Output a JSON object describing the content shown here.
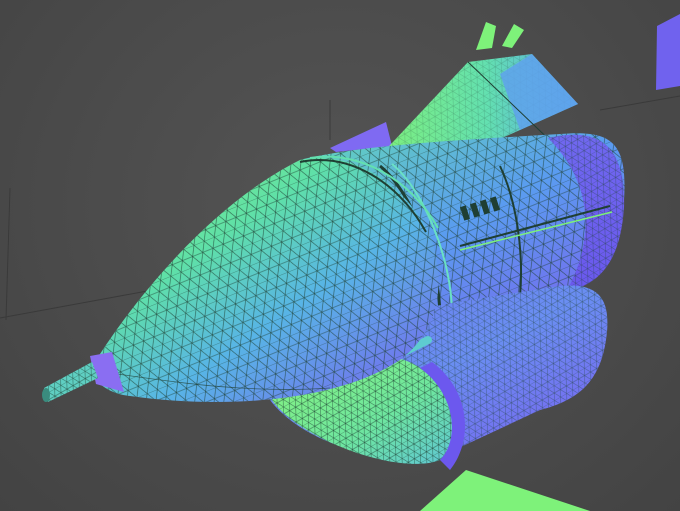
{
  "viewport": {
    "background": "#4a4a4a",
    "shading": "normal-map",
    "display_mode": "wireframe-on-shaded",
    "wire_color": "#1f3f33",
    "palette": {
      "green": "#7ef27a",
      "cyan": "#4fd6d0",
      "blue": "#5a8cf0",
      "violet": "#7b5cf0"
    }
  },
  "model": {
    "parts": [
      "nose-cone",
      "nose-tip-probe",
      "fuselage-midsection",
      "tail-fin",
      "engine-nacelle",
      "intake-ring",
      "side-vents",
      "wing-stub"
    ]
  },
  "icons": {
    "gizmo_handle": "axis-handle-icon"
  }
}
